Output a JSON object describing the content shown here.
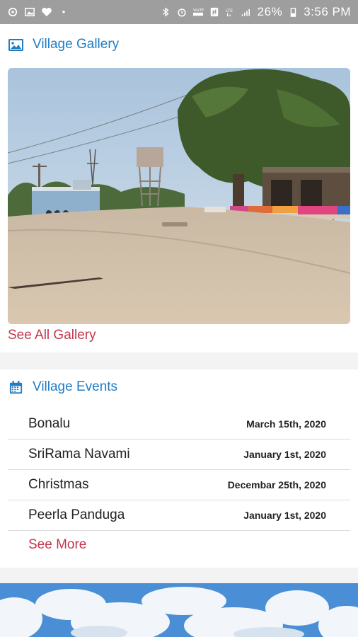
{
  "status_bar": {
    "battery": "26%",
    "time": "3:56 PM",
    "left_icons": [
      "sync-icon",
      "image-icon",
      "heart-icon",
      "dot-icon"
    ],
    "right_icons": [
      "bluetooth-icon",
      "alarm-icon",
      "volte-icon",
      "nfc-icon",
      "lte-icon",
      "signal-icon"
    ]
  },
  "gallery": {
    "title": "Village Gallery",
    "see_all": "See All Gallery"
  },
  "events": {
    "title": "Village Events",
    "items": [
      {
        "name": "Bonalu",
        "date": "March 15th, 2020"
      },
      {
        "name": "SriRama Navami",
        "date": "January 1st, 2020"
      },
      {
        "name": "Christmas",
        "date": "Decembar 25th, 2020"
      },
      {
        "name": "Peerla Panduga",
        "date": "January 1st, 2020"
      }
    ],
    "see_more": "See More"
  },
  "colors": {
    "accent": "#1f7dc4",
    "link": "#c2384d",
    "status_bar": "#9e9e9e"
  }
}
